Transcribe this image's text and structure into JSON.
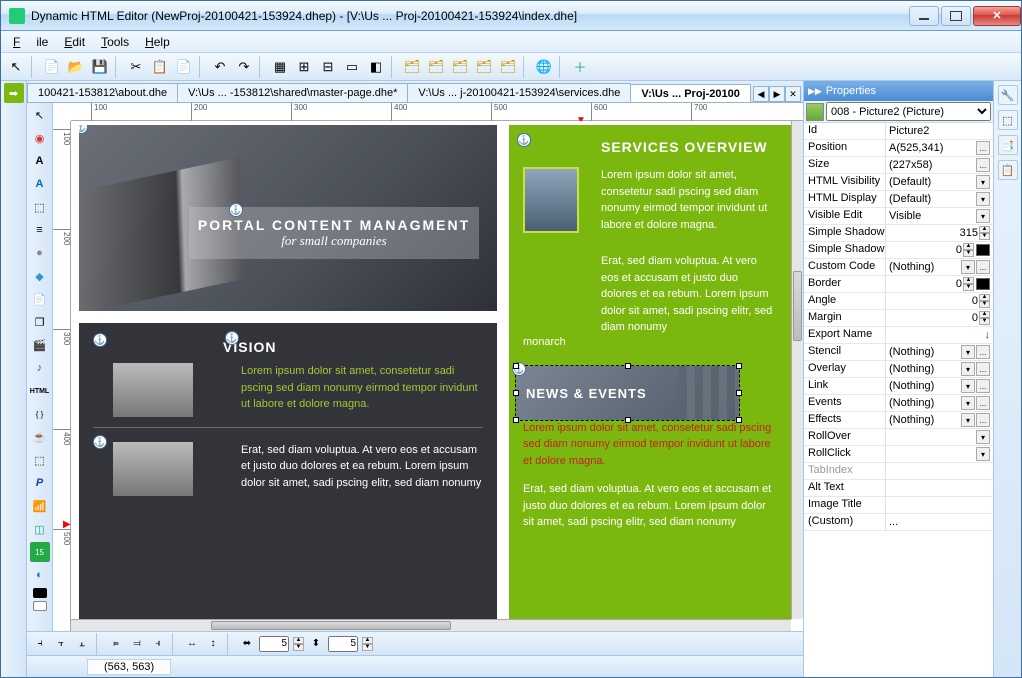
{
  "window": {
    "title": "Dynamic HTML Editor (NewProj-20100421-153924.dhep) - [V:\\Us ... Proj-20100421-153924\\index.dhe]"
  },
  "menu": {
    "file": "File",
    "edit": "Edit",
    "tools": "Tools",
    "help": "Help"
  },
  "toolbar_icons": {
    "pointer": "↖",
    "new": "📄",
    "open": "📂",
    "save": "💾",
    "cut": "✂",
    "copy": "📋",
    "paste": "📄",
    "undo": "↶",
    "redo": "↷",
    "grid": "▦",
    "snap": "⊞",
    "guides": "⊟",
    "align1": "▭",
    "align2": "◧",
    "layers1": "🗂",
    "layers2": "🗂",
    "layers3": "🗂",
    "layers4": "🗂",
    "layers5": "🗂",
    "globe": "🌐",
    "plus": "＋"
  },
  "left_tools": [
    "➡",
    "",
    "↖",
    "○",
    "A",
    "🅰",
    "⬚",
    "≡",
    "●",
    "🔵",
    "📄",
    "❐",
    "🎬",
    "♪",
    "HTML",
    "{}",
    "☕",
    "⬚",
    "💳",
    "🔶",
    "📶",
    "⬚",
    "◐",
    "⬛",
    "⬜"
  ],
  "tool_col": [
    "↖",
    "○",
    "A",
    "🅰",
    "⬚",
    "≡",
    "●",
    "🔵",
    "📄",
    "❐",
    "🎬",
    "♪",
    "HTML",
    "{}",
    "☕",
    "⬚",
    "💳",
    "🔶",
    "📶",
    "⬚",
    "◐",
    "⬛",
    "⬜"
  ],
  "tabs": {
    "items": [
      {
        "label": "100421-153812\\about.dhe"
      },
      {
        "label": "V:\\Us ... -153812\\shared\\master-page.dhe*"
      },
      {
        "label": "V:\\Us ... j-20100421-153924\\services.dhe"
      },
      {
        "label": "V:\\Us ... Proj-20100"
      }
    ],
    "active": 3
  },
  "ruler": {
    "h": [
      "100",
      "200",
      "300",
      "400",
      "500",
      "600",
      "700"
    ],
    "v": [
      "100",
      "200",
      "300",
      "400",
      "500"
    ]
  },
  "design": {
    "hero_title": "PORTAL CONTENT MANAGMENT",
    "hero_sub": "for small companies",
    "vision_title": "VISION",
    "vision_lorem": "Lorem ipsum dolor sit amet, consetetur sadi pscing sed diam nonumy eirmod tempor invidunt ut labore et dolore magna.",
    "vision_erat": "Erat, sed diam voluptua. At vero eos et accusam et justo duo dolores et ea rebum. Lorem ipsum dolor sit amet, sadi pscing elitr, sed diam nonumy",
    "services_title": "SERVICES OVERVIEW",
    "services_lorem": "Lorem ipsum dolor sit amet, consetetur sadi pscing sed diam nonumy eirmod tempor invidunt ut labore et dolore magna.",
    "services_erat": "Erat, sed diam voluptua. At vero eos et accusam et justo duo dolores et ea rebum. Lorem ipsum dolor sit amet, sadi pscing elitr, sed diam nonumy",
    "news_title": "NEWS & EVENTS",
    "news_lorem": "Lorem ipsum dolor sit amet, consetetur sadi pscing sed diam nonumy eirmod tempor invidunt ut labore et dolore magna.",
    "news_erat": "Erat, sed diam voluptua. At vero eos et accusam et justo duo dolores et ea rebum. Lorem ipsum dolor sit amet, sadi pscing elitr, sed diam nonumy"
  },
  "properties": {
    "header": "Properties",
    "object": "008 - Picture2 (Picture)",
    "rows": [
      {
        "name": "Id",
        "value": "Picture2",
        "btns": []
      },
      {
        "name": "Position",
        "value": "A(525,341)",
        "btns": [
          "..."
        ]
      },
      {
        "name": "Size",
        "value": "(227x58)",
        "btns": [
          "..."
        ]
      },
      {
        "name": "HTML Visibility",
        "value": "(Default)",
        "btns": [
          "▾"
        ]
      },
      {
        "name": "HTML Display",
        "value": "(Default)",
        "btns": [
          "▾"
        ]
      },
      {
        "name": "Visible Edit",
        "value": "Visible",
        "btns": [
          "▾"
        ]
      },
      {
        "name": "Simple Shadow",
        "value": "315",
        "btns": [
          "spin"
        ]
      },
      {
        "name": "Simple Shadow",
        "value": "0",
        "btns": [
          "spin",
          "sw"
        ]
      },
      {
        "name": "Custom Code",
        "value": "(Nothing)",
        "btns": [
          "▾",
          "..."
        ]
      },
      {
        "name": "Border",
        "value": "0",
        "btns": [
          "spin",
          "sw"
        ]
      },
      {
        "name": "Angle",
        "value": "0",
        "btns": [
          "spin"
        ]
      },
      {
        "name": "Margin",
        "value": "0",
        "btns": [
          "spin"
        ]
      },
      {
        "name": "Export Name",
        "value": "",
        "btns": [
          "red"
        ]
      },
      {
        "name": "Stencil",
        "value": "(Nothing)",
        "btns": [
          "▾",
          "..."
        ]
      },
      {
        "name": "Overlay",
        "value": "(Nothing)",
        "btns": [
          "▾",
          "..."
        ]
      },
      {
        "name": "Link",
        "value": "(Nothing)",
        "btns": [
          "▾",
          "..."
        ]
      },
      {
        "name": "Events",
        "value": "(Nothing)",
        "btns": [
          "▾",
          "..."
        ]
      },
      {
        "name": "Effects",
        "value": "(Nothing)",
        "btns": [
          "▾",
          "..."
        ]
      },
      {
        "name": "RollOver",
        "value": "",
        "btns": [
          "▾"
        ]
      },
      {
        "name": "RollClick",
        "value": "",
        "btns": [
          "▾"
        ]
      },
      {
        "name": "TabIndex",
        "value": "",
        "btns": [],
        "disabled": true
      },
      {
        "name": "Alt Text",
        "value": "",
        "btns": []
      },
      {
        "name": "Image Title",
        "value": "",
        "btns": []
      },
      {
        "name": "(Custom)",
        "value": "...",
        "btns": []
      }
    ]
  },
  "right_rail": [
    "🔧",
    "⬚",
    "📑",
    "📋"
  ],
  "bottom": {
    "v1": "5",
    "v2": "5"
  },
  "status": {
    "coords": "(563, 563)"
  }
}
